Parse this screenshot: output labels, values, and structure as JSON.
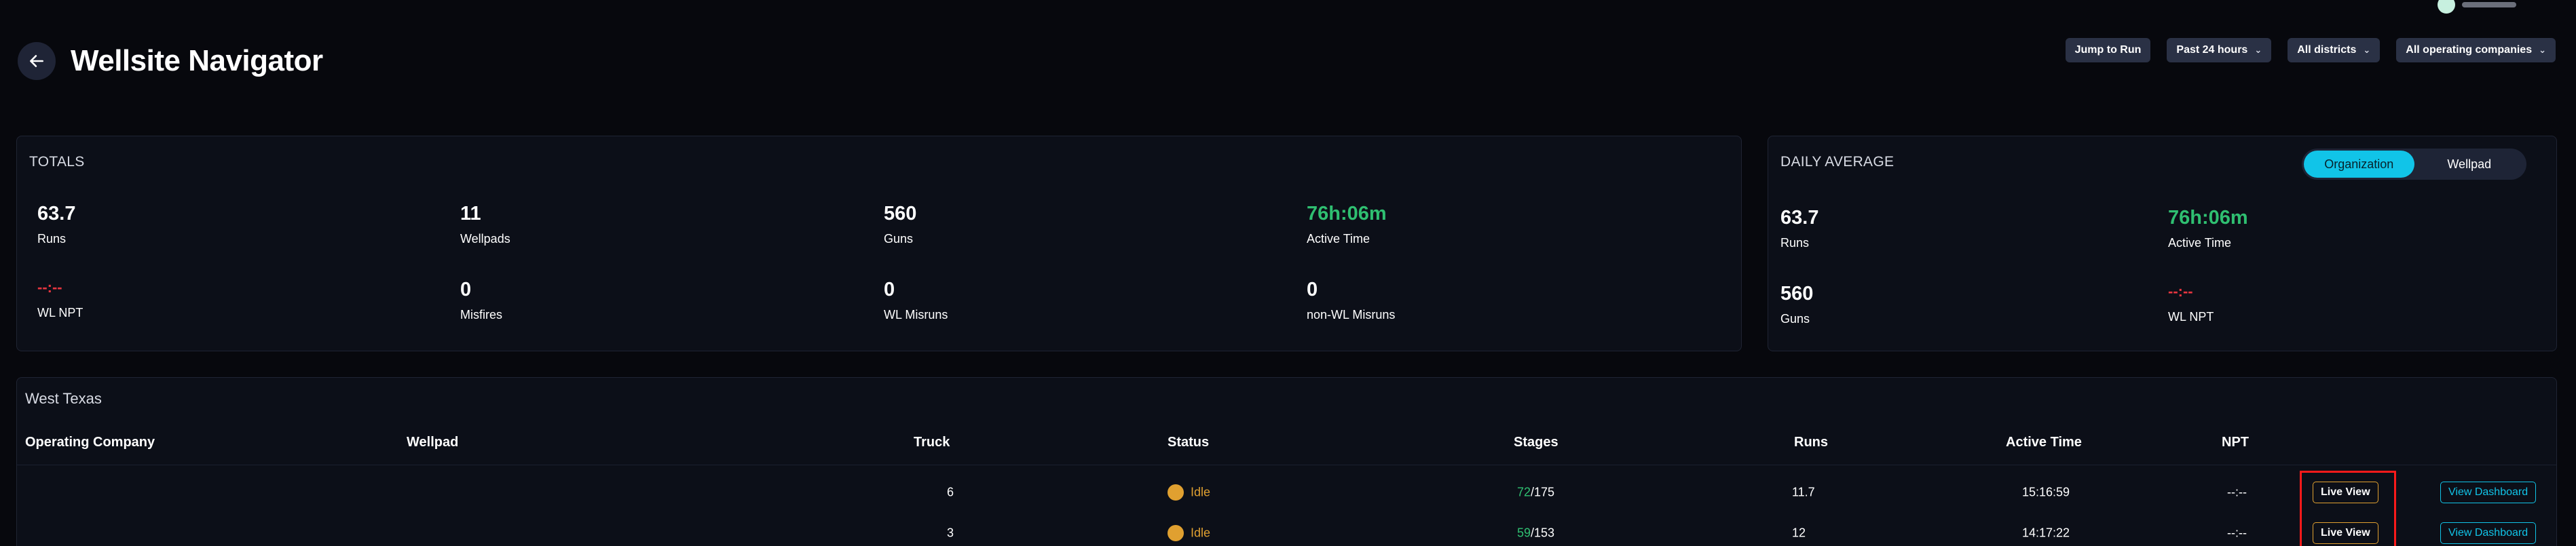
{
  "page": {
    "title": "Wellsite Navigator"
  },
  "filters": {
    "jump_to_run": "Jump to Run",
    "time_range": "Past 24 hours",
    "district": "All districts",
    "company": "All operating companies"
  },
  "totals": {
    "title": "TOTALS",
    "stats": [
      {
        "value": "63.7",
        "label": "Runs"
      },
      {
        "value": "11",
        "label": "Wellpads"
      },
      {
        "value": "560",
        "label": "Guns"
      },
      {
        "value": "76h:06m",
        "label": "Active Time"
      },
      {
        "value": "--:--",
        "label": "WL NPT"
      },
      {
        "value": "0",
        "label": "Misfires"
      },
      {
        "value": "0",
        "label": "WL Misruns"
      },
      {
        "value": "0",
        "label": "non-WL Misruns"
      }
    ]
  },
  "daily": {
    "title": "DAILY AVERAGE",
    "toggle": [
      "Organization",
      "Wellpad"
    ],
    "stats": [
      {
        "value": "63.7",
        "label": "Runs"
      },
      {
        "value": "76h:06m",
        "label": "Active Time"
      },
      {
        "value": "560",
        "label": "Guns"
      },
      {
        "value": "--:--",
        "label": "WL NPT"
      }
    ]
  },
  "district": {
    "name": "West Texas",
    "columns": [
      "Operating Company",
      "Wellpad",
      "Truck",
      "Status",
      "Stages",
      "Runs",
      "Active Time",
      "NPT"
    ],
    "rows": [
      {
        "company": "",
        "wellpad": "",
        "truck": "6",
        "status": "Idle",
        "stages_done": "72",
        "stages_total": "/175",
        "runs": "11.7",
        "active_time": "15:16:59",
        "npt": "--:--",
        "live_label": "Live View",
        "dash_label": "View Dashboard"
      },
      {
        "company": "",
        "wellpad": "",
        "truck": "3",
        "status": "Idle",
        "stages_done": "59",
        "stages_total": "/153",
        "runs": "12",
        "active_time": "14:17:22",
        "npt": "--:--",
        "live_label": "Live View",
        "dash_label": "View Dashboard"
      }
    ]
  },
  "colors": {
    "accent": "#11c4e8",
    "positive": "#2fbf71",
    "negative": "#e8353f",
    "idle": "#e0a030"
  }
}
